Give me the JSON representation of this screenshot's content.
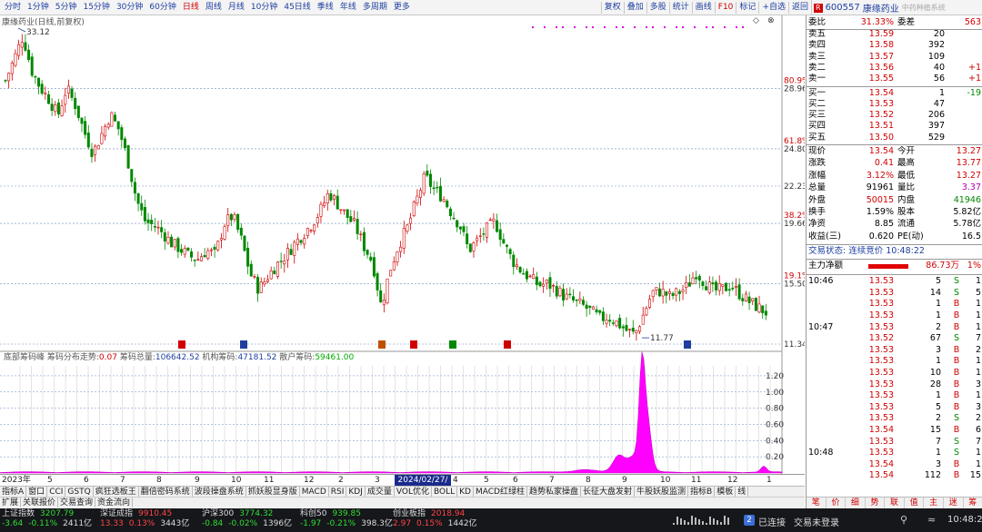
{
  "periods": [
    "分时",
    "1分钟",
    "5分钟",
    "15分钟",
    "30分钟",
    "60分钟",
    "日线",
    "周线",
    "月线",
    "10分钟",
    "45日线",
    "季线",
    "年线",
    "多周期",
    "更多"
  ],
  "active_period": "日线",
  "tools": [
    "复权",
    "叠加",
    "多股",
    "统计",
    "画线",
    "F10",
    "标记",
    "+自选",
    "返回"
  ],
  "stock": {
    "code": "600557",
    "name": "康缘药业",
    "r_badge": "R",
    "pinyin_hint": "中药种植系统"
  },
  "chart_title": "康缘药业(日线,前复权)",
  "price_axis": [
    {
      "v": "28.96",
      "p": "80.9%"
    },
    {
      "v": "24.80",
      "p": "61.8%"
    },
    {
      "v": "22.23",
      "p": ""
    },
    {
      "v": "19.66",
      "p": "38.2%"
    },
    {
      "v": "15.50",
      "p": "19.1%"
    },
    {
      "v": "11.34",
      "p": ""
    }
  ],
  "high_marker": "33.12",
  "low_marker": "11.77",
  "chip_header": {
    "title": "底部筹码峰",
    "dist_label": "筹码分布走势:",
    "dist_val": "0.07",
    "total_label": "筹码总量:",
    "total_val": "106642.52",
    "inst_label": "机构筹码:",
    "inst_val": "47181.52",
    "retail_label": "散户筹码:",
    "retail_val": "59461.00"
  },
  "chip_axis": [
    "1.20",
    "1.00",
    "0.80",
    "0.60",
    "0.40",
    "0.20"
  ],
  "date_axis": {
    "year": "2023年",
    "highlight": "2024/02/27/",
    "months": [
      "5",
      "6",
      "7",
      "8",
      "9",
      "10",
      "11",
      "12",
      "2",
      "3",
      "4",
      "5",
      "6",
      "7",
      "8",
      "9",
      "10",
      "11",
      "12",
      "1"
    ]
  },
  "indicator_tabs": [
    "指标A",
    "窗口",
    "CCI",
    "GSTQ",
    "疯狂选板王",
    "翻倍密码系统",
    "波段操盘系统",
    "抓妖股显身版",
    "MACD",
    "RSI",
    "KDJ",
    "成交量",
    "VOL优化",
    "BOLL",
    "KD",
    "MACD红绿柱",
    "趋势私家操盘",
    "长征大盘发射",
    "牛股妖股监测",
    "指标B",
    "模板",
    "线"
  ],
  "func_tabs": [
    "扩展",
    "关联报价",
    "交易查询",
    "资金流向"
  ],
  "right_bottom_tabs": [
    "笔",
    "价",
    "细",
    "势",
    "联",
    "值",
    "主",
    "迷",
    "筹"
  ],
  "ratio": {
    "wb_label": "委比",
    "wb_val": "31.33%",
    "wc_label": "委差",
    "wc_val": "563"
  },
  "asks": [
    {
      "lbl": "卖五",
      "p": "13.59",
      "v": "20",
      "c": ""
    },
    {
      "lbl": "卖四",
      "p": "13.58",
      "v": "392",
      "c": ""
    },
    {
      "lbl": "卖三",
      "p": "13.57",
      "v": "109",
      "c": ""
    },
    {
      "lbl": "卖二",
      "p": "13.56",
      "v": "40",
      "c": "+1"
    },
    {
      "lbl": "卖一",
      "p": "13.55",
      "v": "56",
      "c": "+1"
    }
  ],
  "bids": [
    {
      "lbl": "买一",
      "p": "13.54",
      "v": "1",
      "c": "-19"
    },
    {
      "lbl": "买二",
      "p": "13.53",
      "v": "47",
      "c": ""
    },
    {
      "lbl": "买三",
      "p": "13.52",
      "v": "206",
      "c": ""
    },
    {
      "lbl": "买四",
      "p": "13.51",
      "v": "397",
      "c": ""
    },
    {
      "lbl": "买五",
      "p": "13.50",
      "v": "529",
      "c": ""
    }
  ],
  "quote": [
    {
      "l1": "现价",
      "v1": "13.54",
      "l2": "今开",
      "v2": "13.27",
      "c1": "red",
      "c2": "red"
    },
    {
      "l1": "涨跌",
      "v1": "0.41",
      "l2": "最高",
      "v2": "13.77",
      "c1": "red",
      "c2": "red"
    },
    {
      "l1": "涨幅",
      "v1": "3.12%",
      "l2": "最低",
      "v2": "13.27",
      "c1": "red",
      "c2": "red"
    },
    {
      "l1": "总量",
      "v1": "91961",
      "l2": "量比",
      "v2": "3.37",
      "c1": "blk",
      "c2": "pur"
    },
    {
      "l1": "外盘",
      "v1": "50015",
      "l2": "内盘",
      "v2": "41946",
      "c1": "red",
      "c2": "grn"
    },
    {
      "l1": "换手",
      "v1": "1.59%",
      "l2": "股本",
      "v2": "5.82亿",
      "c1": "blk",
      "c2": "blk"
    },
    {
      "l1": "净资",
      "v1": "8.85",
      "l2": "流通",
      "v2": "5.78亿",
      "c1": "blk",
      "c2": "blk"
    },
    {
      "l1": "收益(三)",
      "v1": "0.620",
      "l2": "PE(动)",
      "v2": "16.5",
      "c1": "blk",
      "c2": "blk"
    }
  ],
  "trade_status": "交易状态: 连续竞价 10:48:22",
  "main_flow": {
    "label": "主力净额",
    "val": "86.73万",
    "pct": "1%"
  },
  "ticks": [
    {
      "t": "10:46",
      "p": "13.53",
      "v": "5",
      "d": "S",
      "x": "1"
    },
    {
      "t": "",
      "p": "13.53",
      "v": "14",
      "d": "S",
      "x": "5"
    },
    {
      "t": "",
      "p": "13.53",
      "v": "1",
      "d": "B",
      "x": "1"
    },
    {
      "t": "",
      "p": "13.53",
      "v": "1",
      "d": "B",
      "x": "1"
    },
    {
      "t": "10:47",
      "p": "13.53",
      "v": "2",
      "d": "B",
      "x": "1"
    },
    {
      "t": "",
      "p": "13.52",
      "v": "67",
      "d": "S",
      "x": "7"
    },
    {
      "t": "",
      "p": "13.53",
      "v": "3",
      "d": "B",
      "x": "2"
    },
    {
      "t": "",
      "p": "13.53",
      "v": "1",
      "d": "B",
      "x": "1"
    },
    {
      "t": "",
      "p": "13.53",
      "v": "10",
      "d": "B",
      "x": "1"
    },
    {
      "t": "",
      "p": "13.53",
      "v": "28",
      "d": "B",
      "x": "3"
    },
    {
      "t": "",
      "p": "13.53",
      "v": "1",
      "d": "B",
      "x": "1"
    },
    {
      "t": "",
      "p": "13.53",
      "v": "5",
      "d": "B",
      "x": "3"
    },
    {
      "t": "",
      "p": "13.53",
      "v": "2",
      "d": "S",
      "x": "2"
    },
    {
      "t": "",
      "p": "13.54",
      "v": "15",
      "d": "B",
      "x": "6"
    },
    {
      "t": "",
      "p": "13.53",
      "v": "7",
      "d": "S",
      "x": "7"
    },
    {
      "t": "10:48",
      "p": "13.53",
      "v": "1",
      "d": "S",
      "x": "1"
    },
    {
      "t": "",
      "p": "13.54",
      "v": "3",
      "d": "B",
      "x": "1"
    },
    {
      "t": "",
      "p": "13.54",
      "v": "112",
      "d": "B",
      "x": "15"
    }
  ],
  "indices": [
    {
      "name": "上证指数",
      "val": "3207.79",
      "chg": "-3.64",
      "pct": "-0.11%",
      "amt": "2411亿"
    },
    {
      "name": "深证成指",
      "val": "9910.45",
      "chg": "13.33",
      "pct": "0.13%",
      "amt": "3443亿"
    },
    {
      "name": "沪深300",
      "val": "3774.32",
      "chg": "-0.84",
      "pct": "-0.02%",
      "amt": "1396亿"
    },
    {
      "name": "科创50",
      "val": "939.85",
      "chg": "-1.97",
      "pct": "-0.21%",
      "amt": "398.3亿"
    },
    {
      "name": "创业板指",
      "val": "2018.94",
      "chg": "2.97",
      "pct": "0.15%",
      "amt": "1442亿"
    }
  ],
  "status": {
    "connected": "已连接",
    "trade": "交易未登录",
    "badge": "2",
    "time": "10:48:24"
  },
  "colors": {
    "up": "#d00000",
    "down": "#008800",
    "chip": "#ff00ff",
    "bg": "#ffffff",
    "grid": "#6a8ab8"
  },
  "chart_data": {
    "type": "candlestick",
    "price_range": [
      11.34,
      33.12
    ],
    "close_path": [
      29.5,
      31.0,
      32.6,
      30.2,
      29.0,
      28.2,
      27.1,
      29.0,
      27.8,
      26.0,
      24.5,
      25.8,
      27.2,
      26.1,
      24.0,
      21.3,
      19.8,
      19.5,
      19.0,
      18.3,
      17.9,
      17.4,
      17.2,
      17.8,
      17.5,
      19.6,
      20.2,
      18.5,
      16.2,
      15.1,
      16.0,
      16.8,
      17.4,
      18.2,
      18.9,
      19.6,
      20.5,
      21.8,
      21.0,
      20.2,
      19.5,
      18.1,
      17.0,
      13.9,
      16.5,
      18.2,
      19.4,
      21.2,
      22.9,
      22.0,
      21.5,
      20.4,
      19.5,
      17.8,
      18.5,
      19.2,
      19.8,
      18.3,
      17.1,
      16.4,
      15.9,
      15.4,
      15.5,
      15.1,
      14.6,
      14.3,
      14.0,
      13.6,
      13.1,
      13.2,
      12.8,
      12.3,
      12.0,
      13.4,
      14.9,
      15.0,
      14.6,
      14.9,
      15.3,
      16.3,
      15.6,
      15.0,
      15.1,
      15.4,
      14.8,
      14.3,
      13.9,
      13.54
    ],
    "chip_distribution_peak": 1.2
  }
}
